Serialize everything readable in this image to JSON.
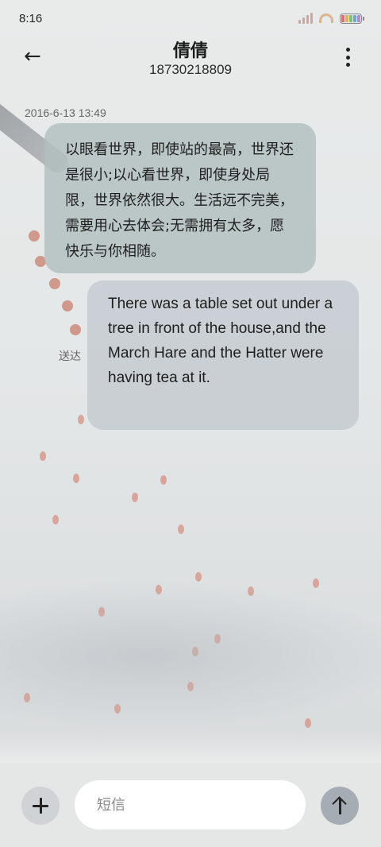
{
  "status_bar": {
    "time": "8:16"
  },
  "header": {
    "back_icon": "arrow-left-icon",
    "contact_name": "倩倩",
    "contact_number": "18730218809",
    "more_icon": "more-vertical-icon"
  },
  "conversation": {
    "timestamp": "2016-6-13 13:49",
    "messages": [
      {
        "text": "以眼看世界，即使站的最高，世界还是很小;以心看世界，即使身处局限，世界依然很大。生活远不完美，需要用心去体会;无需拥有太多，愿快乐与你相随。"
      },
      {
        "text": "There was a table set out under a tree in front of the house,and the March Hare and the Hatter were having tea at it."
      }
    ],
    "status": "送达"
  },
  "input_bar": {
    "add_icon": "plus-icon",
    "placeholder": "短信",
    "send_icon": "arrow-up-icon"
  },
  "colors": {
    "bubble_primary": "#b1c0be",
    "bubble_secondary": "#c8cdd2",
    "send_button": "#a6acb3"
  }
}
